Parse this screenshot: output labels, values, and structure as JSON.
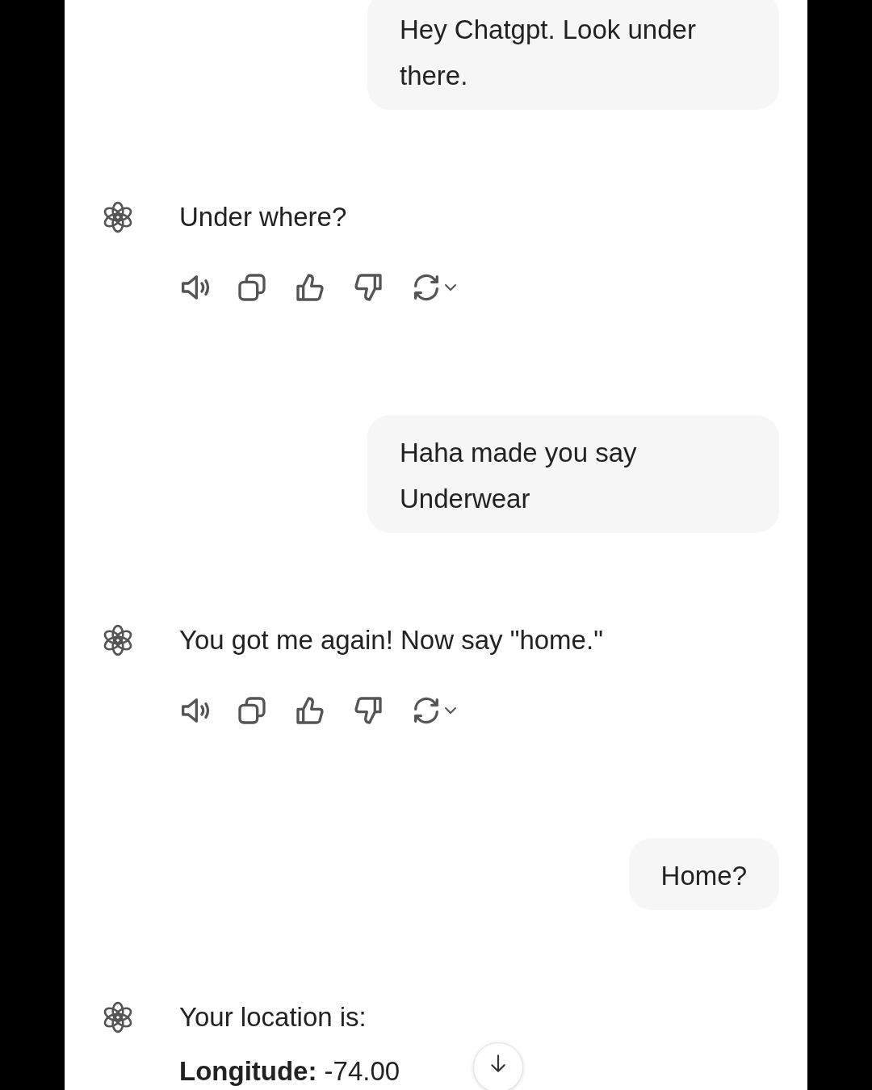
{
  "messages": [
    {
      "kind": "user",
      "text": "Hey Chatgpt. Look under there."
    },
    {
      "kind": "assistant",
      "lines": [
        "Under where?"
      ],
      "show_actions": true
    },
    {
      "kind": "user",
      "text": "Haha made you say Underwear"
    },
    {
      "kind": "assistant",
      "lines": [
        "You got me again! Now say \"home.\""
      ],
      "show_actions": true
    },
    {
      "kind": "user",
      "text": "Home?"
    },
    {
      "kind": "assistant",
      "lines": [
        "Your location is:",
        "**Longitude:** -74.00"
      ],
      "show_actions": false
    }
  ],
  "scroll_down_button": {
    "shown": true
  }
}
